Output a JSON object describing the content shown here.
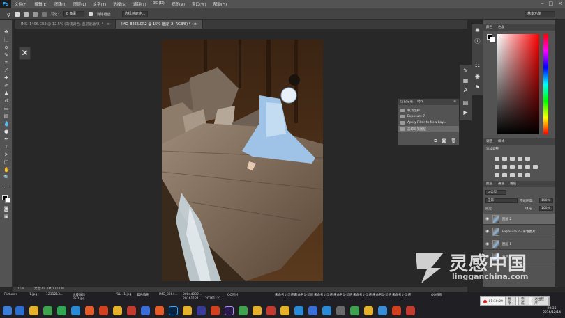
{
  "app": {
    "logo": "Ps",
    "name": "Adobe Photoshop"
  },
  "menus": [
    "文件(F)",
    "编辑(E)",
    "图像(I)",
    "图层(L)",
    "文字(Y)",
    "选择(S)",
    "滤镜(T)",
    "3D(D)",
    "视图(V)",
    "窗口(W)",
    "帮助(H)"
  ],
  "window_controls": {
    "minimize": "–",
    "maximize": "□",
    "close": "×"
  },
  "options_bar": {
    "feather_label": "羽化:",
    "feather_value": "0 像素",
    "antialias_label": "消除锯齿",
    "select_mask_button": "选择并遮住...",
    "workspace": "基本功能"
  },
  "tabs": [
    {
      "label": "IMG_1406.CR2 @ 12.5% (曲线调色, 图层蒙版/8) *",
      "close": "×",
      "active": false
    },
    {
      "label": "IMG_8265.CR2 @ 15% (图层 2, RGB/8) *",
      "close": "×",
      "active": true
    }
  ],
  "status": {
    "zoom": "15%",
    "doc_size": "文档:69.1M/171.0M"
  },
  "history_panel": {
    "tabs": [
      "历史记录",
      "动作"
    ],
    "items": [
      {
        "label": "取消选择",
        "selected": false
      },
      {
        "label": "Exposure 7",
        "selected": false
      },
      {
        "label": "Apply Filter to New Lay...",
        "selected": false
      },
      {
        "label": "盖印可见图层",
        "selected": true
      }
    ]
  },
  "color_panel": {
    "tabs": [
      "颜色",
      "色板"
    ],
    "fg": "#000000",
    "bg": "#ffffff"
  },
  "adjustments_panel": {
    "tabs": [
      "调整",
      "样式"
    ],
    "title": "添加调整"
  },
  "layers_panel": {
    "tabs": [
      "图层",
      "通道",
      "路径"
    ],
    "filter_label": "ρ 类型",
    "blend_mode": "正常",
    "opacity_label": "不透明度:",
    "opacity_value": "100%",
    "lock_label": "锁定:",
    "fill_label": "填充:",
    "fill_value": "100%",
    "layers": [
      {
        "name": "图层 2",
        "visible": true,
        "selected": true,
        "mask": false
      },
      {
        "name": "Exposure 7 - 彩色图片 ...",
        "visible": true,
        "selected": false,
        "mask": false
      },
      {
        "name": "图层 1",
        "visible": true,
        "selected": false,
        "mask": false
      },
      {
        "name": "背景",
        "visible": true,
        "selected": false,
        "mask": false
      }
    ]
  },
  "taskbar": {
    "labels": [
      "Picture+",
      "1.jpg",
      "1231213...",
      "树枝球场",
      "PSD.jpg",
      "f1L...1.jpg",
      "着色情形",
      "IMG_3364...",
      "0084d082...",
      "20161121...",
      "QQ图片",
      "20161121...",
      "未命名1-灵感造",
      "未命名1-灵感",
      "未命名1-灵感",
      "未命名1-灵感",
      "未命名1-灵感",
      "未命名1-灵感",
      "未命名1-灵感",
      "QQ截图"
    ],
    "recorder": {
      "time": "01:10:20",
      "pause": "暂停",
      "stop": "完成",
      "exit": "退出程序"
    },
    "clock_time": "20:36",
    "clock_date": "2016/12/14"
  },
  "watermark": {
    "title": "灵感中国",
    "url": "lingganchina.com"
  },
  "photo_colors": {
    "forest": "#4a2e17",
    "dress": "#9fc3e6",
    "rock": "#8a7866",
    "water": "#c9d6dd"
  }
}
